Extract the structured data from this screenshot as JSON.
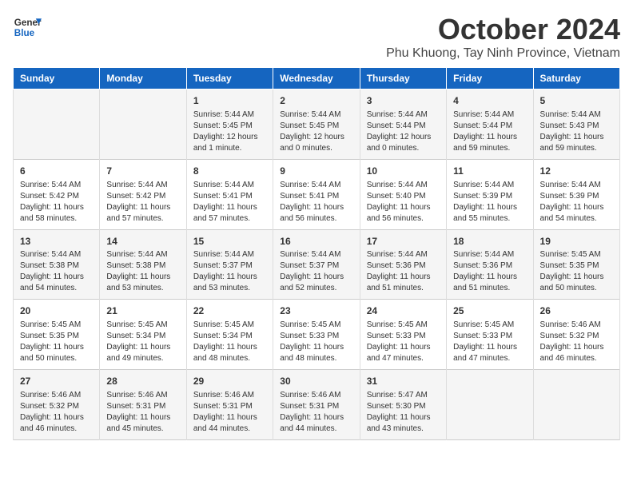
{
  "header": {
    "logo_general": "General",
    "logo_blue": "Blue",
    "month_title": "October 2024",
    "subtitle": "Phu Khuong, Tay Ninh Province, Vietnam"
  },
  "days_of_week": [
    "Sunday",
    "Monday",
    "Tuesday",
    "Wednesday",
    "Thursday",
    "Friday",
    "Saturday"
  ],
  "weeks": [
    [
      {
        "day": "",
        "info": ""
      },
      {
        "day": "",
        "info": ""
      },
      {
        "day": "1",
        "info": "Sunrise: 5:44 AM\nSunset: 5:45 PM\nDaylight: 12 hours and 1 minute."
      },
      {
        "day": "2",
        "info": "Sunrise: 5:44 AM\nSunset: 5:45 PM\nDaylight: 12 hours and 0 minutes."
      },
      {
        "day": "3",
        "info": "Sunrise: 5:44 AM\nSunset: 5:44 PM\nDaylight: 12 hours and 0 minutes."
      },
      {
        "day": "4",
        "info": "Sunrise: 5:44 AM\nSunset: 5:44 PM\nDaylight: 11 hours and 59 minutes."
      },
      {
        "day": "5",
        "info": "Sunrise: 5:44 AM\nSunset: 5:43 PM\nDaylight: 11 hours and 59 minutes."
      }
    ],
    [
      {
        "day": "6",
        "info": "Sunrise: 5:44 AM\nSunset: 5:42 PM\nDaylight: 11 hours and 58 minutes."
      },
      {
        "day": "7",
        "info": "Sunrise: 5:44 AM\nSunset: 5:42 PM\nDaylight: 11 hours and 57 minutes."
      },
      {
        "day": "8",
        "info": "Sunrise: 5:44 AM\nSunset: 5:41 PM\nDaylight: 11 hours and 57 minutes."
      },
      {
        "day": "9",
        "info": "Sunrise: 5:44 AM\nSunset: 5:41 PM\nDaylight: 11 hours and 56 minutes."
      },
      {
        "day": "10",
        "info": "Sunrise: 5:44 AM\nSunset: 5:40 PM\nDaylight: 11 hours and 56 minutes."
      },
      {
        "day": "11",
        "info": "Sunrise: 5:44 AM\nSunset: 5:39 PM\nDaylight: 11 hours and 55 minutes."
      },
      {
        "day": "12",
        "info": "Sunrise: 5:44 AM\nSunset: 5:39 PM\nDaylight: 11 hours and 54 minutes."
      }
    ],
    [
      {
        "day": "13",
        "info": "Sunrise: 5:44 AM\nSunset: 5:38 PM\nDaylight: 11 hours and 54 minutes."
      },
      {
        "day": "14",
        "info": "Sunrise: 5:44 AM\nSunset: 5:38 PM\nDaylight: 11 hours and 53 minutes."
      },
      {
        "day": "15",
        "info": "Sunrise: 5:44 AM\nSunset: 5:37 PM\nDaylight: 11 hours and 53 minutes."
      },
      {
        "day": "16",
        "info": "Sunrise: 5:44 AM\nSunset: 5:37 PM\nDaylight: 11 hours and 52 minutes."
      },
      {
        "day": "17",
        "info": "Sunrise: 5:44 AM\nSunset: 5:36 PM\nDaylight: 11 hours and 51 minutes."
      },
      {
        "day": "18",
        "info": "Sunrise: 5:44 AM\nSunset: 5:36 PM\nDaylight: 11 hours and 51 minutes."
      },
      {
        "day": "19",
        "info": "Sunrise: 5:45 AM\nSunset: 5:35 PM\nDaylight: 11 hours and 50 minutes."
      }
    ],
    [
      {
        "day": "20",
        "info": "Sunrise: 5:45 AM\nSunset: 5:35 PM\nDaylight: 11 hours and 50 minutes."
      },
      {
        "day": "21",
        "info": "Sunrise: 5:45 AM\nSunset: 5:34 PM\nDaylight: 11 hours and 49 minutes."
      },
      {
        "day": "22",
        "info": "Sunrise: 5:45 AM\nSunset: 5:34 PM\nDaylight: 11 hours and 48 minutes."
      },
      {
        "day": "23",
        "info": "Sunrise: 5:45 AM\nSunset: 5:33 PM\nDaylight: 11 hours and 48 minutes."
      },
      {
        "day": "24",
        "info": "Sunrise: 5:45 AM\nSunset: 5:33 PM\nDaylight: 11 hours and 47 minutes."
      },
      {
        "day": "25",
        "info": "Sunrise: 5:45 AM\nSunset: 5:33 PM\nDaylight: 11 hours and 47 minutes."
      },
      {
        "day": "26",
        "info": "Sunrise: 5:46 AM\nSunset: 5:32 PM\nDaylight: 11 hours and 46 minutes."
      }
    ],
    [
      {
        "day": "27",
        "info": "Sunrise: 5:46 AM\nSunset: 5:32 PM\nDaylight: 11 hours and 46 minutes."
      },
      {
        "day": "28",
        "info": "Sunrise: 5:46 AM\nSunset: 5:31 PM\nDaylight: 11 hours and 45 minutes."
      },
      {
        "day": "29",
        "info": "Sunrise: 5:46 AM\nSunset: 5:31 PM\nDaylight: 11 hours and 44 minutes."
      },
      {
        "day": "30",
        "info": "Sunrise: 5:46 AM\nSunset: 5:31 PM\nDaylight: 11 hours and 44 minutes."
      },
      {
        "day": "31",
        "info": "Sunrise: 5:47 AM\nSunset: 5:30 PM\nDaylight: 11 hours and 43 minutes."
      },
      {
        "day": "",
        "info": ""
      },
      {
        "day": "",
        "info": ""
      }
    ]
  ]
}
